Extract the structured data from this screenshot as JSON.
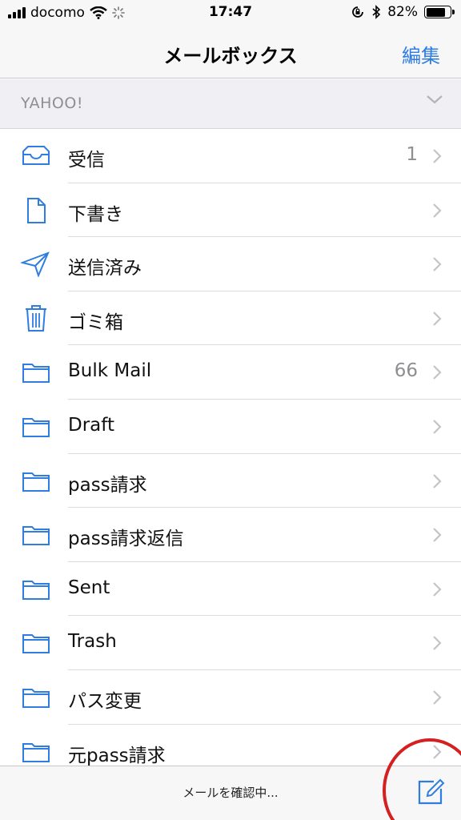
{
  "status_bar": {
    "carrier": "docomo",
    "time": "17:47",
    "battery": "82%",
    "battery_level": 0.82
  },
  "nav": {
    "title": "メールボックス",
    "edit": "編集"
  },
  "section": {
    "label": "YAHOO!"
  },
  "mailboxes": [
    {
      "label": "受信",
      "count": "1",
      "icon": "inbox-icon"
    },
    {
      "label": "下書き",
      "count": "",
      "icon": "document-icon"
    },
    {
      "label": "送信済み",
      "count": "",
      "icon": "paper-plane-icon"
    },
    {
      "label": "ゴミ箱",
      "count": "",
      "icon": "trash-icon"
    },
    {
      "label": "Bulk Mail",
      "count": "66",
      "icon": "folder-icon"
    },
    {
      "label": "Draft",
      "count": "",
      "icon": "folder-icon"
    },
    {
      "label": "pass請求",
      "count": "",
      "icon": "folder-icon"
    },
    {
      "label": "pass請求返信",
      "count": "",
      "icon": "folder-icon"
    },
    {
      "label": "Sent",
      "count": "",
      "icon": "folder-icon"
    },
    {
      "label": "Trash",
      "count": "",
      "icon": "folder-icon"
    },
    {
      "label": "パス変更",
      "count": "",
      "icon": "folder-icon"
    },
    {
      "label": "元pass請求",
      "count": "",
      "icon": "folder-icon"
    }
  ],
  "toolbar": {
    "status": "メールを確認中..."
  },
  "colors": {
    "accent": "#2f7de1",
    "annotation": "#d42020"
  }
}
